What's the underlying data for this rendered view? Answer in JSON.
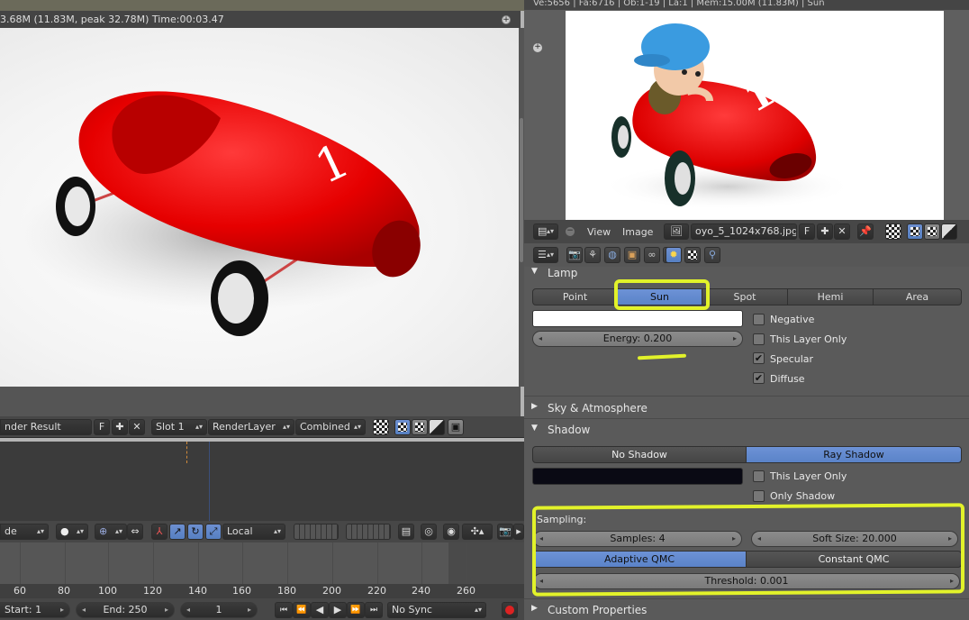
{
  "render_view": {
    "status_text": "3.68M (11.83M, peak 32.78M) Time:00:03.47",
    "race_number": "1"
  },
  "image_header": {
    "image_name": "nder Result",
    "fake_user": "F",
    "slot": "Slot 1",
    "render_layer": "RenderLayer",
    "pass": "Combined"
  },
  "view3d_header": {
    "mode": "de",
    "orientation": "Local"
  },
  "timeline": {
    "ticks": [
      "60",
      "80",
      "100",
      "120",
      "140",
      "160",
      "180",
      "200",
      "220",
      "240",
      "260"
    ]
  },
  "playback": {
    "start": "Start: 1",
    "end": "End: 250",
    "current": "1",
    "sync": "No Sync"
  },
  "top_info": "Ve:5656 | Fa:6716 | Ob:1-19 | La:1 | Mem:15.00M (11.83M) | Sun",
  "uv_header": {
    "view_menu": "View",
    "image_menu": "Image",
    "image_name": "oyo_5_1024x768.jpg",
    "fake_user": "F"
  },
  "reference_image": {
    "race_number": "1"
  },
  "lamp_panel": {
    "title": "Lamp",
    "types": [
      "Point",
      "Sun",
      "Spot",
      "Hemi",
      "Area"
    ],
    "selected_type": "Sun",
    "energy": "Energy: 0.200",
    "color": "#ffffff",
    "options": [
      {
        "label": "Negative",
        "checked": false
      },
      {
        "label": "This Layer Only",
        "checked": false
      },
      {
        "label": "Specular",
        "checked": true
      },
      {
        "label": "Diffuse",
        "checked": true
      }
    ]
  },
  "sky_panel": {
    "title": "Sky & Atmosphere"
  },
  "shadow_panel": {
    "title": "Shadow",
    "modes": [
      "No Shadow",
      "Ray Shadow"
    ],
    "selected_mode": "Ray Shadow",
    "shadow_color": "#0a0a14",
    "options": [
      {
        "label": "This Layer Only",
        "checked": false
      },
      {
        "label": "Only Shadow",
        "checked": false
      }
    ],
    "sampling_label": "Sampling:",
    "samples": "Samples: 4",
    "soft_size": "Soft Size: 20.000",
    "methods": [
      "Adaptive QMC",
      "Constant QMC"
    ],
    "selected_method": "Adaptive QMC",
    "threshold": "Threshold: 0.001"
  },
  "custom_panel": {
    "title": "Custom Properties"
  },
  "colors": {
    "accent_blue": "#5a83c8",
    "highlight": "#e2f22a",
    "car_red": "#e00000"
  }
}
